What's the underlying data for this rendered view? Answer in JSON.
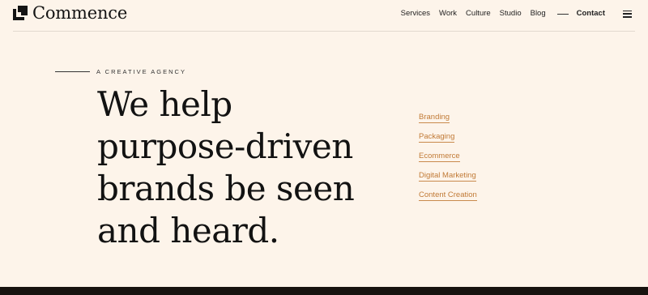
{
  "header": {
    "logo_text": "Commence",
    "nav": [
      {
        "label": "Services"
      },
      {
        "label": "Work"
      },
      {
        "label": "Culture"
      },
      {
        "label": "Studio"
      },
      {
        "label": "Blog"
      }
    ],
    "contact_label": "Contact",
    "menu_icon": "hamburger-icon"
  },
  "hero": {
    "eyebrow": "A CREATIVE AGENCY",
    "headline_lines": [
      "We help",
      "purpose-driven",
      "brands be seen",
      "and heard."
    ]
  },
  "services": [
    {
      "label": "Branding"
    },
    {
      "label": "Packaging"
    },
    {
      "label": "Ecommerce"
    },
    {
      "label": "Digital Marketing"
    },
    {
      "label": "Content Creation"
    }
  ],
  "colors": {
    "background": "#fdf4ea",
    "text": "#141414",
    "accent": "#c17a36",
    "footer": "#17130f"
  }
}
